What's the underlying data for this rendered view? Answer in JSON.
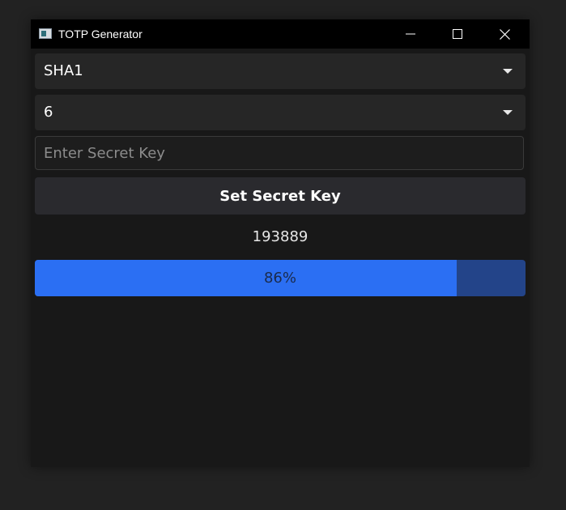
{
  "window": {
    "title": "TOTP Generator",
    "icon": "app-icon"
  },
  "controls": {
    "algorithm": {
      "selected": "SHA1",
      "icon": "chevron-down-icon"
    },
    "digits": {
      "selected": "6",
      "icon": "chevron-down-icon"
    },
    "secret_input": {
      "value": "",
      "placeholder": "Enter Secret Key"
    },
    "set_button_label": "Set Secret Key"
  },
  "output": {
    "code": "193889"
  },
  "progress": {
    "value": 0.86,
    "label": "86%"
  },
  "colors": {
    "accent": "#2b6ff3",
    "progress_track": "#234489",
    "window_bg": "#181818",
    "titlebar_bg": "#000000"
  }
}
